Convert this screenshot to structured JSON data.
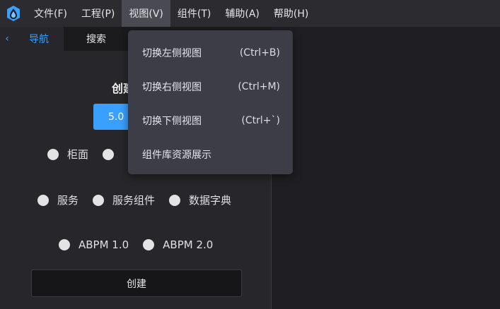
{
  "menubar": {
    "items": [
      {
        "label": "文件(F)"
      },
      {
        "label": "工程(P)"
      },
      {
        "label": "视图(V)"
      },
      {
        "label": "组件(T)"
      },
      {
        "label": "辅助(A)"
      },
      {
        "label": "帮助(H)"
      }
    ]
  },
  "tabs": {
    "back": "‹",
    "nav": "导航",
    "search": "搜索"
  },
  "create": {
    "title": "创建",
    "version": "5.0",
    "row1": [
      "柜面",
      ""
    ],
    "row2": [
      "服务",
      "服务组件",
      "数据字典"
    ],
    "row3": [
      "ABPM 1.0",
      "ABPM 2.0"
    ],
    "button": "创建"
  },
  "view_menu": {
    "items": [
      {
        "label": "切换左侧视图",
        "shortcut": "(Ctrl+B)"
      },
      {
        "label": "切换右侧视图",
        "shortcut": "(Ctrl+M)"
      },
      {
        "label": "切换下侧视图",
        "shortcut": "(Ctrl+`)"
      },
      {
        "label": "组件库资源展示",
        "shortcut": ""
      }
    ]
  },
  "colors": {
    "accent": "#3aa0ff",
    "menubar_bg": "#2b2b30",
    "panel_bg": "#27272b",
    "dropdown_bg": "#3d3d47"
  }
}
